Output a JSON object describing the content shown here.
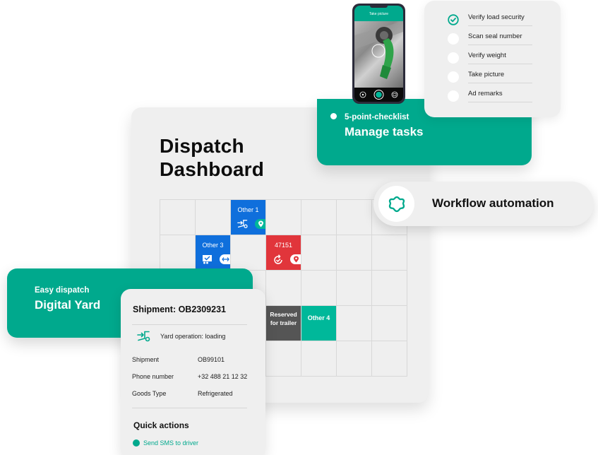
{
  "dashboard": {
    "title": "Dispatch\nDashboard",
    "grid": {
      "rows": 5,
      "cols": 7,
      "slots": [
        {
          "label": "Other 1",
          "row": 0,
          "col": 2,
          "color": "blue",
          "icon": "yard-operation-icon",
          "badge": "location-pin-icon",
          "badge_color": "#00b89a"
        },
        {
          "label": "Other 3",
          "row": 1,
          "col": 1,
          "color": "blue",
          "icon": "truck-check-icon",
          "badge": "swap-arrows-icon",
          "badge_color": "#0f6fdc"
        },
        {
          "label": "47151",
          "row": 1,
          "col": 3,
          "color": "red",
          "icon": "refresh-check-icon",
          "badge": "location-pin-icon",
          "badge_color": "#e1353b"
        },
        {
          "label": "Reserved for trailer",
          "row": 3,
          "col": 3,
          "color": "dark"
        },
        {
          "label": "Other 4",
          "row": 3,
          "col": 4,
          "color": "teal"
        }
      ]
    }
  },
  "phone": {
    "header": "Take picture",
    "buttons": [
      "flash-icon",
      "shutter-button",
      "gallery-icon"
    ]
  },
  "checklist": {
    "items": [
      {
        "label": "Verify load security",
        "checked": true
      },
      {
        "label": "Scan seal number",
        "checked": false
      },
      {
        "label": "Verify weight",
        "checked": false
      },
      {
        "label": "Take picture",
        "checked": false
      },
      {
        "label": "Ad remarks",
        "checked": false
      }
    ]
  },
  "tasks_card": {
    "subtitle": "5-point-checklist",
    "title": "Manage tasks"
  },
  "workflow": {
    "label": "Workflow automation",
    "icon": "gear-flower-icon"
  },
  "yard_card": {
    "subtitle": "Easy dispatch",
    "title": "Digital Yard"
  },
  "shipment": {
    "title": "Shipment: OB2309231",
    "operation": "Yard operation: loading",
    "fields": [
      {
        "key": "Shipment",
        "value": "OB99101"
      },
      {
        "key": "Phone number",
        "value": "+32 488 21 12 32"
      },
      {
        "key": "Goods Type",
        "value": "Refrigerated"
      }
    ],
    "quick_actions_title": "Quick actions",
    "quick_actions": [
      {
        "label": "Send SMS to driver"
      }
    ]
  },
  "colors": {
    "brand_green": "#00a98d",
    "slot_blue": "#0f6fdc",
    "slot_red": "#e1353b",
    "slot_dark": "#555555",
    "slot_teal": "#00b89a"
  }
}
